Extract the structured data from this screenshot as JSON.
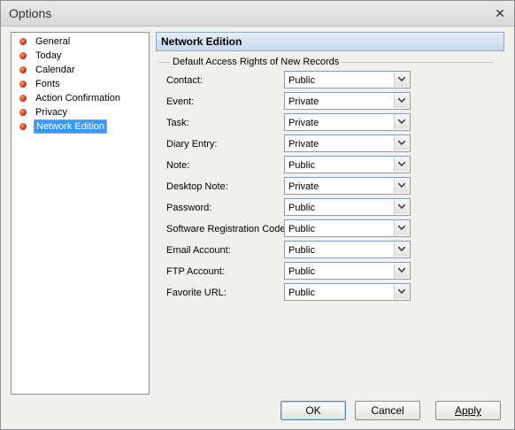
{
  "window": {
    "title": "Options"
  },
  "nav": {
    "items": [
      {
        "label": "General"
      },
      {
        "label": "Today"
      },
      {
        "label": "Calendar"
      },
      {
        "label": "Fonts"
      },
      {
        "label": "Action Confirmation"
      },
      {
        "label": "Privacy"
      },
      {
        "label": "Network Edition",
        "selected": true
      }
    ]
  },
  "panel": {
    "title": "Network Edition",
    "group_title": "Default Access Rights of New Records",
    "fields": [
      {
        "label": "Contact:",
        "value": "Public"
      },
      {
        "label": "Event:",
        "value": "Private"
      },
      {
        "label": "Task:",
        "value": "Private"
      },
      {
        "label": "Diary Entry:",
        "value": "Private"
      },
      {
        "label": "Note:",
        "value": "Public"
      },
      {
        "label": "Desktop Note:",
        "value": "Private"
      },
      {
        "label": "Password:",
        "value": "Public"
      },
      {
        "label": "Software Registration Code:",
        "value": "Public"
      },
      {
        "label": "Email Account:",
        "value": "Public"
      },
      {
        "label": "FTP Account:",
        "value": "Public"
      },
      {
        "label": "Favorite URL:",
        "value": "Public"
      }
    ]
  },
  "buttons": {
    "ok": "OK",
    "cancel": "Cancel",
    "apply": "Apply"
  },
  "icons": {
    "close": "close-icon",
    "nav_bullet": "red-bullet-icon",
    "dropdown": "chevron-down-icon"
  },
  "colors": {
    "selection": "#3399ff",
    "header_bg": "#c7d8ee",
    "bullet": "#c3361b"
  }
}
